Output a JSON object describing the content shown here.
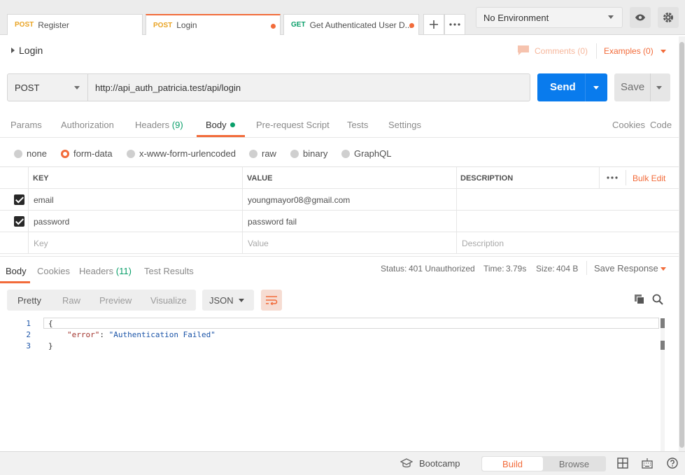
{
  "tabs": [
    {
      "method": "POST",
      "label": "Register",
      "unsaved": false,
      "active": false
    },
    {
      "method": "POST",
      "label": "Login",
      "unsaved": true,
      "active": true
    },
    {
      "method": "GET",
      "label": "Get Authenticated User D...",
      "unsaved": true,
      "active": false
    }
  ],
  "environment": {
    "selected": "No Environment"
  },
  "request": {
    "name": "Login",
    "comments_label": "Comments (0)",
    "examples_label": "Examples (0)",
    "method": "POST",
    "url": "http://api_auth_patricia.test/api/login",
    "send_label": "Send",
    "save_label": "Save"
  },
  "request_tabs": {
    "params": "Params",
    "authorization": "Authorization",
    "headers": "Headers",
    "headers_count": "(9)",
    "body": "Body",
    "prerequest": "Pre-request Script",
    "tests": "Tests",
    "settings": "Settings",
    "cookies": "Cookies",
    "code": "Code"
  },
  "body_types": {
    "none": "none",
    "form_data": "form-data",
    "urlencoded": "x-www-form-urlencoded",
    "raw": "raw",
    "binary": "binary",
    "graphql": "GraphQL",
    "selected": "form-data"
  },
  "params_table": {
    "headers": {
      "key": "KEY",
      "value": "VALUE",
      "description": "DESCRIPTION",
      "bulk_edit": "Bulk Edit"
    },
    "rows": [
      {
        "key": "email",
        "value": "youngmayor08@gmail.com",
        "description": "",
        "checked": true
      },
      {
        "key": "password",
        "value": "password fail",
        "description": "",
        "checked": true
      }
    ],
    "placeholders": {
      "key": "Key",
      "value": "Value",
      "description": "Description"
    }
  },
  "response_tabs": {
    "body": "Body",
    "cookies": "Cookies",
    "headers": "Headers",
    "headers_count": "(11)",
    "test_results": "Test Results"
  },
  "response_meta": {
    "status_label": "Status:",
    "status_value": "401 Unauthorized",
    "time_label": "Time:",
    "time_value": "3.79s",
    "size_label": "Size:",
    "size_value": "404 B",
    "save_response": "Save Response"
  },
  "format": {
    "pretty": "Pretty",
    "raw": "Raw",
    "preview": "Preview",
    "visualize": "Visualize",
    "language": "JSON"
  },
  "editor": {
    "lines": [
      {
        "n": "1",
        "open": "{"
      },
      {
        "n": "2",
        "key": "\"error\"",
        "colon": ": ",
        "value": "\"Authentication Failed\""
      },
      {
        "n": "3",
        "close": "}"
      }
    ]
  },
  "bottom": {
    "bootcamp": "Bootcamp",
    "build": "Build",
    "browse": "Browse"
  },
  "colors": {
    "accent": "#f26b3a",
    "primary": "#097bed",
    "success": "#0a9f6a"
  }
}
